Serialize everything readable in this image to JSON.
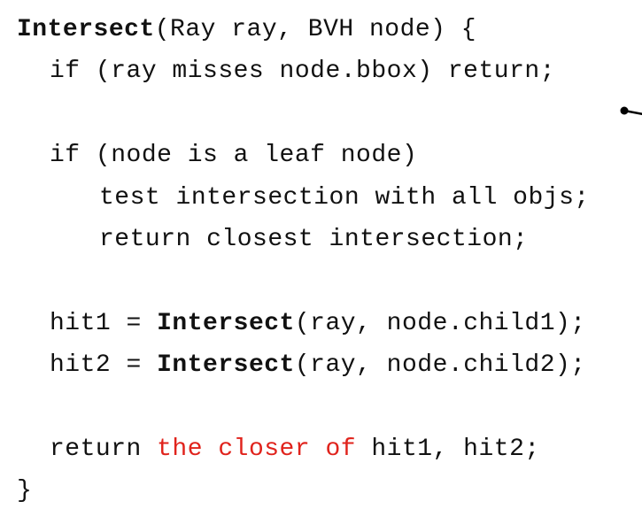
{
  "code": {
    "fn_name": "Intersect",
    "signature": "(Ray ray, BVH node) {",
    "line_bbox": "if (ray misses node.bbox) return;",
    "line_leaf_if": "if (node is a leaf node)",
    "line_test": "test intersection with all objs;",
    "line_return_closest": "return closest intersection;",
    "hit1_lhs": "hit1 = ",
    "hit1_call": "Intersect",
    "hit1_args": "(ray, node.child1);",
    "hit2_lhs": "hit2 = ",
    "hit2_call": "Intersect",
    "hit2_args": "(ray, node.child2);",
    "ret_kw": "return ",
    "ret_highlight": "the closer of",
    "ret_rest": " hit1, hit2;",
    "closing_brace": "}"
  },
  "colors": {
    "text": "#111111",
    "highlight": "#e0231c"
  },
  "icons": {
    "pointer": "annotation-pointer-icon"
  }
}
